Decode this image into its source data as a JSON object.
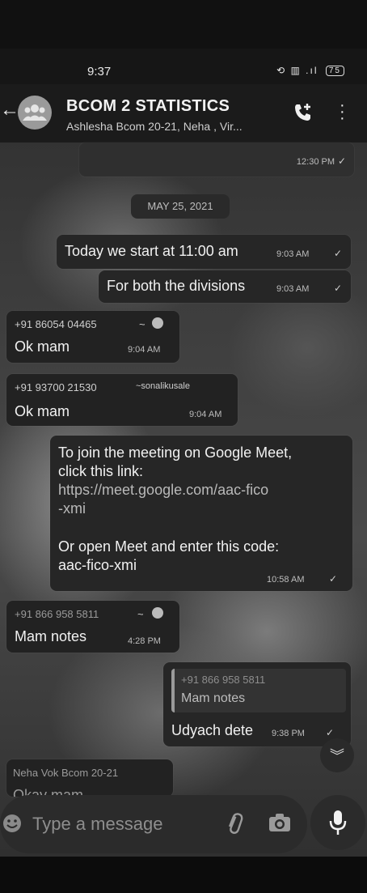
{
  "status_bar": {
    "time": "9:37",
    "icons": "⟲ ▥ .ıl",
    "battery": "75"
  },
  "header": {
    "title": "BCOM 2 STATISTICS",
    "subtitle": "Ashlesha Bcom 20-21, Neha , Vir..."
  },
  "prev_message": {
    "time": "12:30 PM"
  },
  "date_chip": "MAY 25, 2021",
  "messages": [
    {
      "text": "Today we start at 11:00 am",
      "time": "9:03 AM"
    },
    {
      "text": "For both the divisions",
      "time": "9:03 AM"
    },
    {
      "sender": "+91 86054 04465",
      "sender_suffix": "~",
      "text": "Ok mam",
      "time": "9:04 AM"
    },
    {
      "sender": "+91 93700 21530",
      "sender_suffix": "~sonalikusale",
      "text": "Ok mam",
      "time": "9:04 AM"
    },
    {
      "line1": "To join the meeting on Google Meet,",
      "line2": "click this link:",
      "link1": "https://meet.google.com/aac-fico",
      "link2": "-xmi",
      "line3": "Or open Meet and enter this code:",
      "code": "aac-fico-xmi",
      "time": "10:58 AM"
    },
    {
      "sender": "+91 866 958 5811",
      "sender_suffix": "~",
      "text": "Mam notes",
      "time": "4:28 PM"
    },
    {
      "quote_sender": "+91 866 958 5811",
      "quote_text": "Mam notes",
      "text": "Udyach dete",
      "time": "9:38 PM"
    },
    {
      "sender": "Neha Vok Bcom 20-21",
      "text": "Okay mam"
    }
  ],
  "input": {
    "placeholder": "Type a message"
  },
  "colors": {
    "bubble_in": "#222222",
    "bubble_out": "#262626",
    "header": "#1b1b1b"
  }
}
